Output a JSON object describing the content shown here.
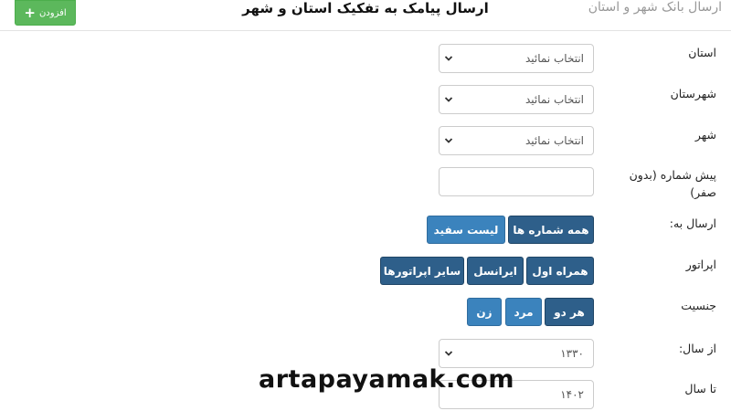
{
  "header": {
    "breadcrumb": "ارسال بانک شهر و استان",
    "title": "ارسال پیامک به تفکیک استان و شهر",
    "add_label": "افزودن",
    "add_icon": "plus-icon"
  },
  "form": {
    "province": {
      "label": "استان",
      "value": "انتخاب نمائید"
    },
    "county": {
      "label": "شهرستان",
      "value": "انتخاب نمائید"
    },
    "city": {
      "label": "شهر",
      "value": "انتخاب نمائید"
    },
    "prefix": {
      "label_line1": "پیش شماره (بدون",
      "label_line2": "صفر)",
      "value": ""
    },
    "send_to": {
      "label": "ارسال به:",
      "options": [
        "همه شماره ها",
        "لیست سفید"
      ]
    },
    "operator": {
      "label": "اپراتور",
      "options": [
        "همراه اول",
        "ایرانسل",
        "سایر اپراتورها"
      ]
    },
    "gender": {
      "label": "جنسیت",
      "options": [
        "هر دو",
        "مرد",
        "زن"
      ]
    },
    "from_year": {
      "label": "از سال:",
      "value": "۱۳۳۰"
    },
    "to_year": {
      "label": "تا سال",
      "value": "۱۴۰۲"
    }
  },
  "watermark": "artapayamak.com",
  "colors": {
    "primary": "#2e5f8a",
    "primary_light": "#3b83bd",
    "success": "#5cb85c"
  }
}
